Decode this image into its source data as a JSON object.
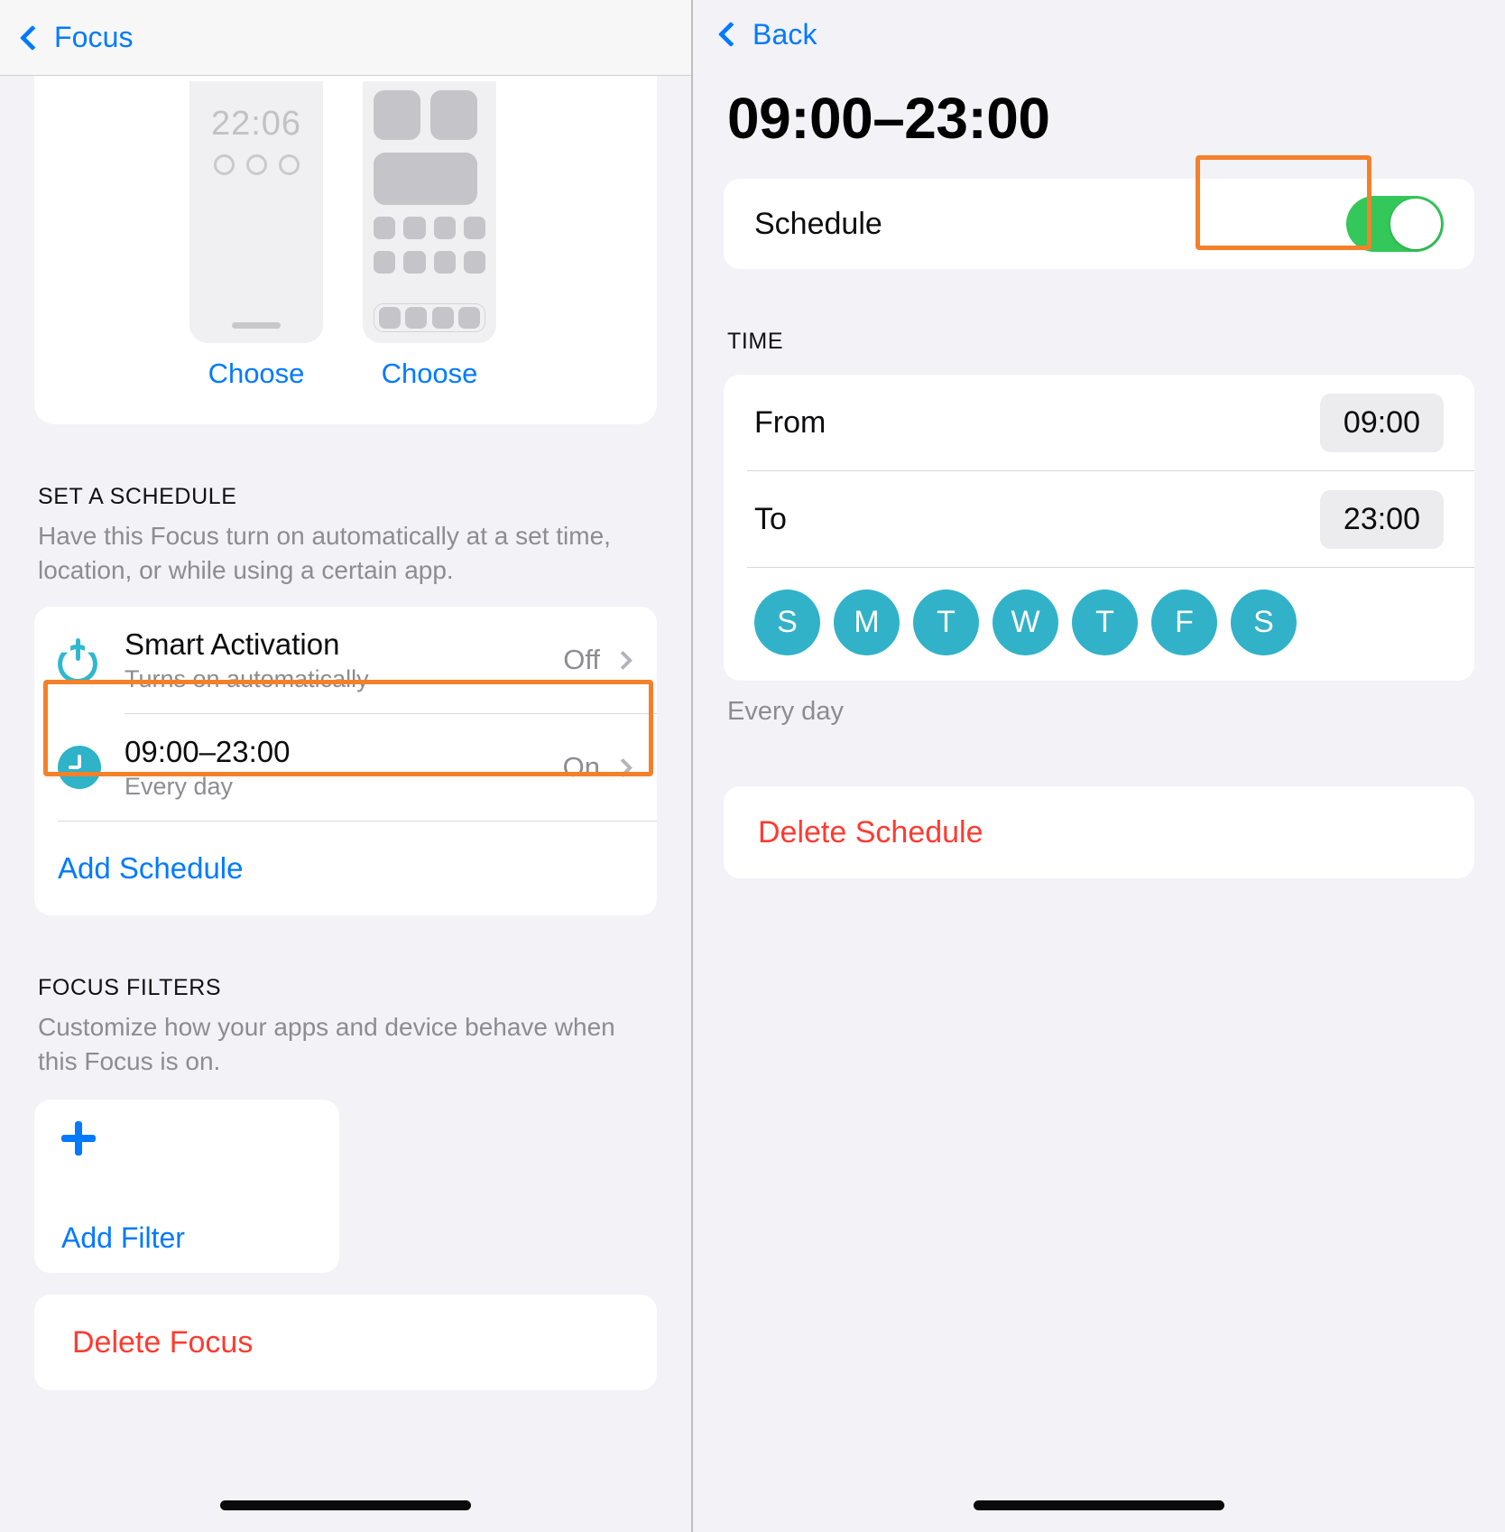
{
  "left": {
    "nav": {
      "back_label": "Focus",
      "back_icon": "chevron-left-icon"
    },
    "preview": {
      "lock_time": "22:06",
      "lock_choose_label": "Choose",
      "home_choose_label": "Choose"
    },
    "schedule_section": {
      "header": "SET A SCHEDULE",
      "description": "Have this Focus turn on automatically at a set time, location, or while using a certain app.",
      "rows": [
        {
          "icon": "power-icon",
          "title": "Smart Activation",
          "subtitle": "Turns on automatically",
          "value": "Off",
          "accessory": "chevron-right-icon"
        },
        {
          "icon": "clock-icon",
          "title": "09:00–23:00",
          "subtitle": "Every day",
          "value": "On",
          "accessory": "chevron-right-icon"
        }
      ],
      "add_label": "Add Schedule"
    },
    "filters_section": {
      "header": "FOCUS FILTERS",
      "description": "Customize how your apps and device behave when this Focus is on.",
      "add_icon": "plus-icon",
      "add_label": "Add Filter"
    },
    "delete_label": "Delete Focus"
  },
  "right": {
    "nav": {
      "back_label": "Back",
      "back_icon": "chevron-left-icon"
    },
    "title": "09:00–23:00",
    "schedule_row": {
      "label": "Schedule",
      "toggle_state": "on"
    },
    "time_section": {
      "header": "TIME",
      "from_label": "From",
      "from_value": "09:00",
      "to_label": "To",
      "to_value": "23:00",
      "days": [
        {
          "letter": "S",
          "selected": true
        },
        {
          "letter": "M",
          "selected": true
        },
        {
          "letter": "T",
          "selected": true
        },
        {
          "letter": "W",
          "selected": true
        },
        {
          "letter": "T",
          "selected": true
        },
        {
          "letter": "F",
          "selected": true
        },
        {
          "letter": "S",
          "selected": true
        }
      ],
      "footer": "Every day"
    },
    "delete_label": "Delete Schedule"
  },
  "colors": {
    "accent_blue": "#007aff",
    "destructive_red": "#ff3b30",
    "toggle_green": "#34c759",
    "day_teal": "#31b2c9",
    "highlight_orange": "#f5802a",
    "background": "#f2f2f7"
  }
}
